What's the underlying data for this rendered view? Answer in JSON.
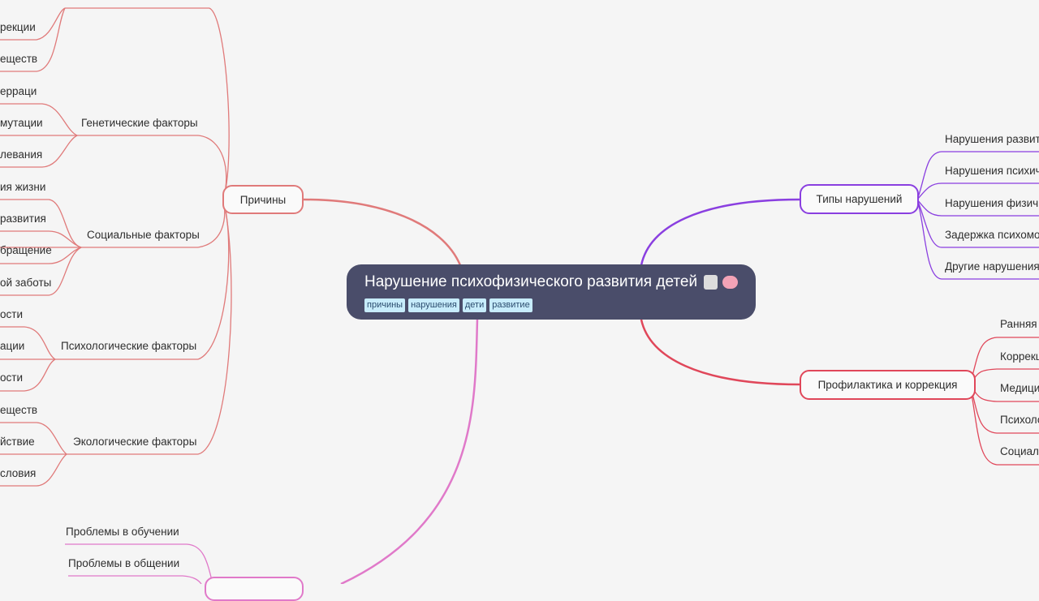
{
  "root": {
    "title": "Нарушение психофизического развития детей",
    "tags": [
      "причины",
      "нарушения",
      "дети",
      "развитие"
    ]
  },
  "branches": {
    "causes": {
      "label": "Причины",
      "color": "#e07a7a",
      "groups": [
        {
          "label": "",
          "items": [
            "рекции",
            "еществ"
          ]
        },
        {
          "label": "Генетические факторы",
          "items": [
            "ерраци",
            "мутации",
            "левания"
          ]
        },
        {
          "label": "Социальные факторы",
          "items": [
            "ия жизни",
            "развития",
            "бращение",
            "ой заботы"
          ]
        },
        {
          "label": "Психологические факторы",
          "items": [
            "ости",
            "ации",
            "ости"
          ]
        },
        {
          "label": "Экологические факторы",
          "items": [
            "еществ",
            "йствие",
            "словия"
          ]
        }
      ]
    },
    "types": {
      "label": "Типы нарушений",
      "color": "#8a3fe0",
      "items": [
        "Нарушения развит",
        "Нарушения психич",
        "Нарушения физич",
        "Задержка психомо",
        "Другие нарушения"
      ]
    },
    "prevention": {
      "label": "Профилактика и коррекция",
      "color": "#e0475a",
      "items": [
        "Ранняя",
        "Коррекц",
        "Медици",
        "Психоло",
        "Социал"
      ]
    },
    "consequences": {
      "label": "",
      "color": "#e079c9",
      "items": [
        "Проблемы в обучении",
        "Проблемы в общении"
      ]
    }
  }
}
